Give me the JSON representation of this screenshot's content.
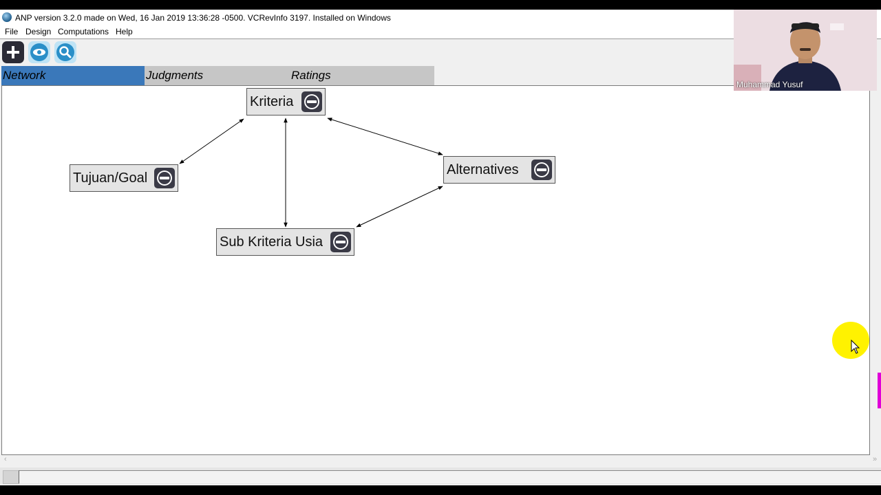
{
  "window": {
    "title": "ANP version 3.2.0 made on Wed, 16 Jan 2019 13:36:28 -0500.  VCRevInfo 3197.  Installed on Windows"
  },
  "menu": {
    "items": [
      {
        "label": "File"
      },
      {
        "label": "Design"
      },
      {
        "label": "Computations"
      },
      {
        "label": "Help"
      }
    ]
  },
  "toolbar": {
    "buttons": [
      {
        "icon": "plus-icon",
        "color": "#2b2b36"
      },
      {
        "icon": "eye-icon",
        "color": "#2a8fc8"
      },
      {
        "icon": "magnifier-icon",
        "color": "#2a8fc8"
      }
    ]
  },
  "tabs": [
    {
      "label": "Network",
      "active": true
    },
    {
      "label": "Judgments",
      "active": false
    },
    {
      "label": "Ratings",
      "active": false
    }
  ],
  "network": {
    "nodes": [
      {
        "label": "Kriteria"
      },
      {
        "label": "Tujuan/Goal"
      },
      {
        "label": "Alternatives"
      },
      {
        "label": "Sub Kriteria Usia"
      }
    ],
    "links": [
      {
        "from": "Kriteria",
        "to": "Tujuan/Goal"
      },
      {
        "from": "Kriteria",
        "to": "Sub Kriteria Usia"
      },
      {
        "from": "Kriteria",
        "to": "Alternatives"
      },
      {
        "from": "Alternatives",
        "to": "Sub Kriteria Usia"
      }
    ]
  },
  "video_overlay": {
    "participant_name": "Muhammad Yusuf"
  },
  "colors": {
    "active_tab": "#3a78ba",
    "inactive_tab": "#c6c6c6",
    "node_fill": "#e4e4e4",
    "node_button": "#3a3a46",
    "cursor_highlight": "#fff200"
  }
}
